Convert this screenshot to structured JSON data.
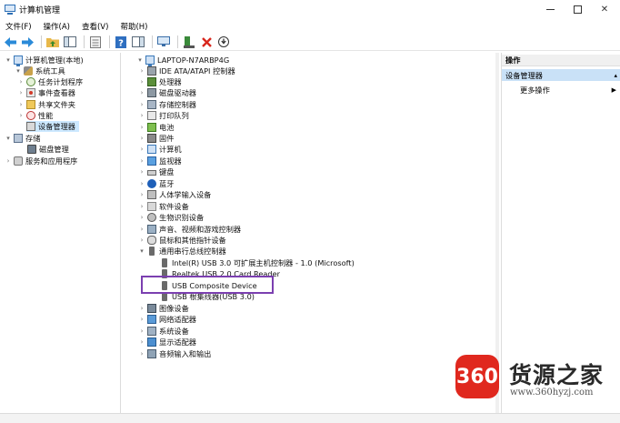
{
  "window": {
    "title": "计算机管理",
    "controls": {
      "minimize": "—",
      "maximize": "□",
      "close": "✕"
    }
  },
  "menu": [
    "文件(F)",
    "操作(A)",
    "查看(V)",
    "帮助(H)"
  ],
  "toolbar": {
    "icons": [
      "back-arrow-icon",
      "forward-arrow-icon",
      "up-folder-icon",
      "console-tree-icon",
      "properties-icon",
      "help-icon",
      "action-pane-icon",
      "monitor-icon",
      "update-driver-icon",
      "delete-icon",
      "download-icon"
    ],
    "colors": {
      "back": "#2a8ad8",
      "forward": "#2a8ad8",
      "delete": "#d8261c"
    }
  },
  "left_tree": [
    {
      "label": "计算机管理(本地)",
      "indent": 0,
      "expander": "▾",
      "icon": "computer-icon"
    },
    {
      "label": "系统工具",
      "indent": 1,
      "expander": "▾",
      "icon": "tools-icon"
    },
    {
      "label": "任务计划程序",
      "indent": 2,
      "expander": "›",
      "icon": "clock-icon"
    },
    {
      "label": "事件查看器",
      "indent": 2,
      "expander": "›",
      "icon": "event-viewer-icon"
    },
    {
      "label": "共享文件夹",
      "indent": 2,
      "expander": "›",
      "icon": "shared-folder-icon"
    },
    {
      "label": "性能",
      "indent": 2,
      "expander": "›",
      "icon": "performance-icon"
    },
    {
      "label": "设备管理器",
      "indent": 2,
      "expander": "",
      "icon": "device-manager-icon",
      "selected": true
    },
    {
      "label": "存储",
      "indent": 1,
      "expander": "▾",
      "icon": "storage-icon"
    },
    {
      "label": "磁盘管理",
      "indent": 2,
      "expander": "",
      "icon": "disk-icon"
    },
    {
      "label": "服务和应用程序",
      "indent": 1,
      "expander": "›",
      "icon": "services-icon"
    }
  ],
  "device_tree": {
    "root": "LAPTOP-N7ARBP4G",
    "items": [
      {
        "label": "IDE ATA/ATAPI 控制器",
        "icon": "ide-icon"
      },
      {
        "label": "处理器",
        "icon": "processor-icon"
      },
      {
        "label": "磁盘驱动器",
        "icon": "disk-drive-icon"
      },
      {
        "label": "存储控制器",
        "icon": "storage-controller-icon"
      },
      {
        "label": "打印队列",
        "icon": "printer-icon"
      },
      {
        "label": "电池",
        "icon": "battery-icon"
      },
      {
        "label": "固件",
        "icon": "firmware-icon"
      },
      {
        "label": "计算机",
        "icon": "computer-icon"
      },
      {
        "label": "监视器",
        "icon": "monitor-icon"
      },
      {
        "label": "键盘",
        "icon": "keyboard-icon"
      },
      {
        "label": "蓝牙",
        "icon": "bluetooth-icon"
      },
      {
        "label": "人体学输入设备",
        "icon": "hid-icon"
      },
      {
        "label": "软件设备",
        "icon": "software-device-icon"
      },
      {
        "label": "生物识别设备",
        "icon": "biometric-icon"
      },
      {
        "label": "声音、视频和游戏控制器",
        "icon": "sound-icon"
      },
      {
        "label": "鼠标和其他指针设备",
        "icon": "mouse-icon"
      },
      {
        "label": "通用串行总线控制器",
        "icon": "usb-icon",
        "expanded": true
      },
      {
        "label": "Intel(R) USB 3.0 可扩展主机控制器 - 1.0 (Microsoft)",
        "icon": "usb-icon",
        "child": true
      },
      {
        "label": "Realtek USB 2.0 Card Reader",
        "icon": "usb-icon",
        "child": true
      },
      {
        "label": "USB Composite Device",
        "icon": "usb-icon",
        "child": true,
        "highlighted": true
      },
      {
        "label": "USB 根集线器(USB 3.0)",
        "icon": "usb-icon",
        "child": true
      },
      {
        "label": "图像设备",
        "icon": "imaging-icon"
      },
      {
        "label": "网络适配器",
        "icon": "network-icon"
      },
      {
        "label": "系统设备",
        "icon": "system-device-icon"
      },
      {
        "label": "显示适配器",
        "icon": "display-adapter-icon"
      },
      {
        "label": "音频输入和输出",
        "icon": "audio-icon"
      }
    ]
  },
  "actions": {
    "header": "操作",
    "section": "设备管理器",
    "more": "更多操作"
  },
  "watermark": {
    "logo_text": "360",
    "brand": "货源之家",
    "url": "www.360hyzj.com",
    "color": "#e0281e"
  }
}
